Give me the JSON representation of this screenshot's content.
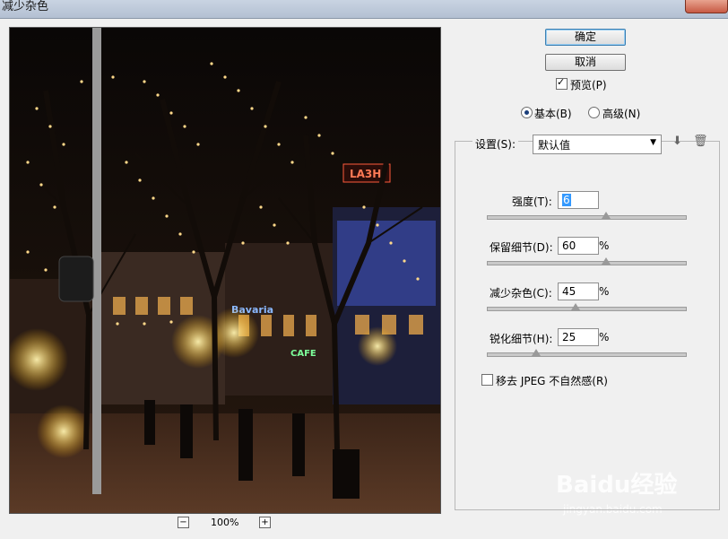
{
  "window": {
    "title": "减少杂色"
  },
  "buttons": {
    "ok": "确定",
    "cancel": "取消"
  },
  "preview_check": {
    "label": "预览(P)",
    "checked": true
  },
  "mode": {
    "basic": "基本(B)",
    "advanced": "高级(N)",
    "selected": "basic"
  },
  "settings": {
    "label": "设置(S):",
    "value": "默认值"
  },
  "params": [
    {
      "label": "强度(T):",
      "value": "6",
      "unit": "",
      "level": 0.6
    },
    {
      "label": "保留细节(D):",
      "value": "60",
      "unit": "%",
      "level": 0.6
    },
    {
      "label": "减少杂色(C):",
      "value": "45",
      "unit": "%",
      "level": 0.45
    },
    {
      "label": "锐化细节(H):",
      "value": "25",
      "unit": "%",
      "level": 0.25
    }
  ],
  "jpeg_check": {
    "label": "移去 JPEG 不自然感(R)",
    "checked": false
  },
  "zoom": {
    "minus": "−",
    "level": "100%",
    "plus": "+"
  },
  "preview_signs": {
    "sign1": "LA3H",
    "sign2": "Bavaria",
    "sign3": "CAFE"
  },
  "watermark": {
    "brand": "Baidu经验",
    "url": "jingyan.baidu.com"
  },
  "colors": {
    "dialog_bg": "#f0f0f0",
    "accent": "#3c7fb1"
  }
}
